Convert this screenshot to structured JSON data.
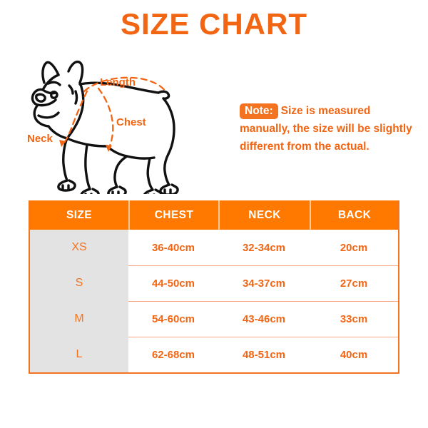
{
  "title": "SIZE CHART",
  "colors": {
    "brand_orange": "#F26513",
    "header_orange": "#FF7800",
    "badge_orange": "#F47321",
    "row_divider": "#F9A582",
    "size_column_gray": "#E3E3E3",
    "outline_black": "#000000"
  },
  "illustration": {
    "name": "french-bulldog-measurement-diagram",
    "labels": {
      "length": "Length",
      "chest": "Chest",
      "neck": "Neck"
    }
  },
  "note": {
    "badge": "Note:",
    "text": "Size is measured manually, the size will be slightly different from the actual."
  },
  "table": {
    "columns": [
      "SIZE",
      "CHEST",
      "NECK",
      "BACK"
    ],
    "rows": [
      {
        "size": "XS",
        "chest": "36-40cm",
        "neck": "32-34cm",
        "back": "20cm"
      },
      {
        "size": "S",
        "chest": "44-50cm",
        "neck": "34-37cm",
        "back": "27cm"
      },
      {
        "size": "M",
        "chest": "54-60cm",
        "neck": "43-46cm",
        "back": "33cm"
      },
      {
        "size": "L",
        "chest": "62-68cm",
        "neck": "48-51cm",
        "back": "40cm"
      }
    ]
  }
}
